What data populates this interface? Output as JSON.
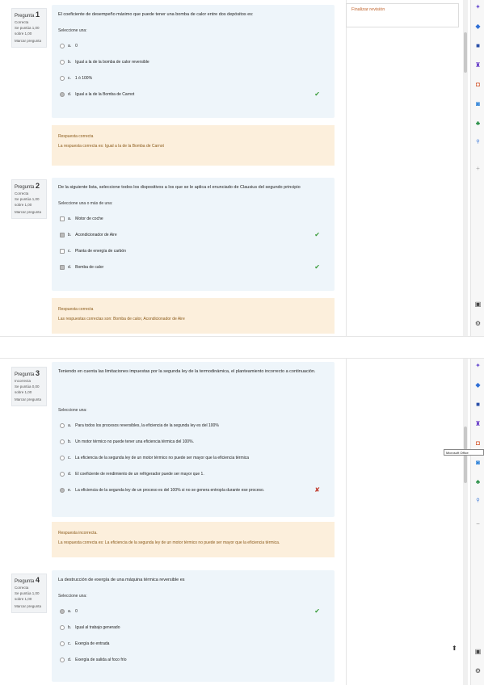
{
  "side": {
    "finish_review": "Finalizar revisión"
  },
  "questions": [
    {
      "info": {
        "label": "Pregunta",
        "number": "1",
        "status": "Correcta",
        "score": "Se puntúa 1,00 sobre 1,00",
        "flag": "Marcar pregunta"
      },
      "text": "El coeficiente de desempeño máximo que puede tener una bomba de calor entre dos depósitos es:",
      "prompt": "Seleccione una:",
      "options": [
        {
          "letter": "a.",
          "text": "0",
          "selected": false,
          "mark": ""
        },
        {
          "letter": "b.",
          "text": "Igual a la de la bomba de calor reversible",
          "selected": false,
          "mark": ""
        },
        {
          "letter": "c.",
          "text": "1 ó 100%",
          "selected": false,
          "mark": ""
        },
        {
          "letter": "d.",
          "text": "Igual a la de la Bomba de Carnot",
          "selected": true,
          "mark": "✔"
        }
      ],
      "feedback_title": "Respuesta correcta",
      "feedback_text": "La respuesta correcta es: Igual a la de la Bomba de Carnot"
    },
    {
      "info": {
        "label": "Pregunta",
        "number": "2",
        "status": "Correcta",
        "score": "Se puntúa 1,00 sobre 1,00",
        "flag": "Marcar pregunta"
      },
      "text": "De la siguiente lista, seleccione todos los dispositivos a los que se le aplica el enunciado de Clausius del segundo principio",
      "prompt": "Seleccione una o más de una:",
      "options": [
        {
          "letter": "a.",
          "text": "Motor de coche",
          "selected": false,
          "mark": ""
        },
        {
          "letter": "b.",
          "text": "Acondicionador de Aire",
          "selected": true,
          "mark": "✔"
        },
        {
          "letter": "c.",
          "text": "Planta de energía de carbón",
          "selected": false,
          "mark": ""
        },
        {
          "letter": "d.",
          "text": "Bomba de calor",
          "selected": true,
          "mark": "✔"
        }
      ],
      "feedback_title": "Respuesta correcta",
      "feedback_text": "Las respuestas correctas son: Bomba de calor, Acondicionador de Aire"
    },
    {
      "info": {
        "label": "Pregunta",
        "number": "3",
        "status": "Incorrecta",
        "score": "Se puntúa 0,00 sobre 1,00",
        "flag": "Marcar pregunta"
      },
      "text": "Teniendo en cuenta las limitaciones impuestas por la segunda ley de la termodinámica, el planteamiento incorrecto a continuación.",
      "prompt": "Seleccione una:",
      "options": [
        {
          "letter": "a.",
          "text": "Para todos los procesos reversibles, la eficiencia de la segunda ley es del 100%",
          "selected": false,
          "mark": ""
        },
        {
          "letter": "b.",
          "text": "Un motor térmico no puede tener una eficiencia térmica del 100%.",
          "selected": false,
          "mark": ""
        },
        {
          "letter": "c.",
          "text": "La eficiencia de la segunda ley de un motor térmico no puede ser mayor que la eficiencia térmica",
          "selected": false,
          "mark": ""
        },
        {
          "letter": "d.",
          "text": "El coeficiente de rendimiento de un refrigerador puede ser mayor que 1.",
          "selected": false,
          "mark": ""
        },
        {
          "letter": "e.",
          "text": "La eficiencia de la segunda ley de un proceso es del 100% si no se genera entropía durante ese proceso.",
          "selected": true,
          "mark": "✘"
        }
      ],
      "feedback_title": "Respuesta incorrecta.",
      "feedback_text": "La respuesta correcta es: La eficiencia de la segunda ley de un motor térmico no puede ser mayor que la eficiencia térmica."
    },
    {
      "info": {
        "label": "Pregunta",
        "number": "4",
        "status": "Correcta",
        "score": "Se puntúa 1,00 sobre 1,00",
        "flag": "Marcar pregunta"
      },
      "text": "La destrucción de exergía de una máquina térmica reversible es",
      "prompt": "Seleccione una:",
      "options": [
        {
          "letter": "a.",
          "text": "0",
          "selected": true,
          "mark": "✔"
        },
        {
          "letter": "b.",
          "text": "Igual al trabajo generado",
          "selected": false,
          "mark": ""
        },
        {
          "letter": "c.",
          "text": "Exergía de entrada",
          "selected": false,
          "mark": ""
        },
        {
          "letter": "d.",
          "text": "Exergía de salida al foco frío",
          "selected": false,
          "mark": ""
        }
      ]
    }
  ],
  "tooltip": "Microsoft Office",
  "colors": {
    "question_bg": "#eef5fa",
    "feedback_bg": "#fcefdc",
    "correct": "#3a9c3a",
    "incorrect": "#c0392b"
  }
}
